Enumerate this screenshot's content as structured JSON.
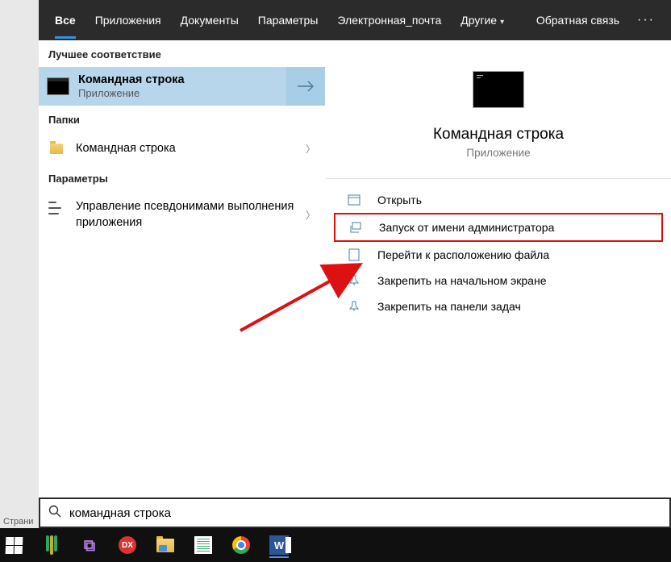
{
  "tabs": {
    "all": "Все",
    "apps": "Приложения",
    "docs": "Документы",
    "params": "Параметры",
    "email": "Электронная_почта",
    "other": "Другие",
    "feedback": "Обратная связь"
  },
  "sections": {
    "best_match": "Лучшее соответствие",
    "folders": "Папки",
    "settings": "Параметры"
  },
  "best_match": {
    "title": "Командная строка",
    "subtitle": "Приложение"
  },
  "folder_result": {
    "title": "Командная строка"
  },
  "setting_result": {
    "title": "Управление псевдонимами выполнения приложения"
  },
  "preview": {
    "title": "Командная строка",
    "subtitle": "Приложение"
  },
  "actions": {
    "open": "Открыть",
    "run_admin": "Запуск от имени администратора",
    "open_location": "Перейти к расположению файла",
    "pin_start": "Закрепить на начальном экране",
    "pin_taskbar": "Закрепить на панели задач"
  },
  "search": {
    "value": "командная строка"
  },
  "status": "Страни"
}
